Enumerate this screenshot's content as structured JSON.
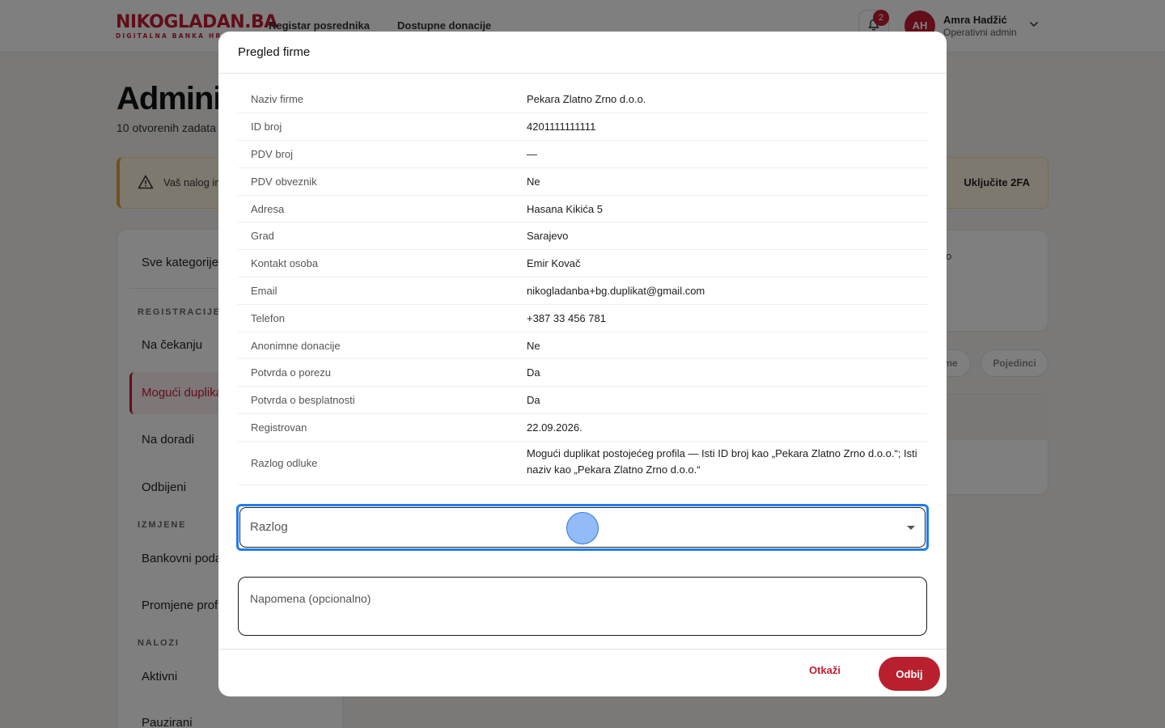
{
  "brand": {
    "name": "NIKOGLADAN.BA",
    "tagline": "DIGITALNA BANKA HRANE",
    "accent": "#c21d32"
  },
  "nav": {
    "items": [
      "Registar posrednika",
      "Dostupne donacije"
    ]
  },
  "notifications": {
    "count": "2"
  },
  "user": {
    "initials": "AH",
    "name": "Amra Hadžić",
    "role": "Operativni admin"
  },
  "page": {
    "title": "Adminis",
    "subtitle": "10 otvorenih zadata",
    "alert": {
      "text": "Vaš nalog im",
      "action": "Uključite 2FA"
    }
  },
  "sidebar": {
    "all": "Sve kategorije",
    "groups": [
      {
        "title": "REGISTRACIJE",
        "items": [
          "Na čekanju",
          "Mogući duplika",
          "Na doradi",
          "Odbijeni"
        ]
      },
      {
        "title": "IZMJENE",
        "items": [
          "Bankovni poda",
          "Promjene profi"
        ]
      },
      {
        "title": "NALOZI",
        "items": [
          "Aktivni",
          "Pauzirani"
        ]
      }
    ]
  },
  "right": {
    "card_text": "o",
    "chips": [
      "me",
      "Pojedinci"
    ]
  },
  "modal": {
    "title": "Pregled firme",
    "rows": [
      {
        "label": "Naziv firme",
        "value": "Pekara Zlatno Zrno d.o.o."
      },
      {
        "label": "ID broj",
        "value": "4201111111111"
      },
      {
        "label": "PDV broj",
        "value": "—"
      },
      {
        "label": "PDV obveznik",
        "value": "Ne"
      },
      {
        "label": "Adresa",
        "value": "Hasana Kikića 5"
      },
      {
        "label": "Grad",
        "value": "Sarajevo"
      },
      {
        "label": "Kontakt osoba",
        "value": "Emir Kovač"
      },
      {
        "label": "Email",
        "value": "nikogladanba+bg.duplikat@gmail.com"
      },
      {
        "label": "Telefon",
        "value": "+387 33 456 781"
      },
      {
        "label": "Anonimne donacije",
        "value": "Ne"
      },
      {
        "label": "Potvrda o porezu",
        "value": "Da"
      },
      {
        "label": "Potvrda o besplatnosti",
        "value": "Da"
      },
      {
        "label": "Registrovan",
        "value": "22.09.2026."
      },
      {
        "label": "Razlog odluke",
        "value": "Mogući duplikat postojećeg profila — Isti ID broj kao „Pekara Zlatno Zrno d.o.o.“; Isti naziv kao „Pekara Zlatno Zrno d.o.o.“"
      }
    ],
    "reason_placeholder": "Razlog",
    "note_placeholder": "Napomena (opcionalno)",
    "cancel_label": "Otkaži",
    "reject_label": "Odbij"
  }
}
